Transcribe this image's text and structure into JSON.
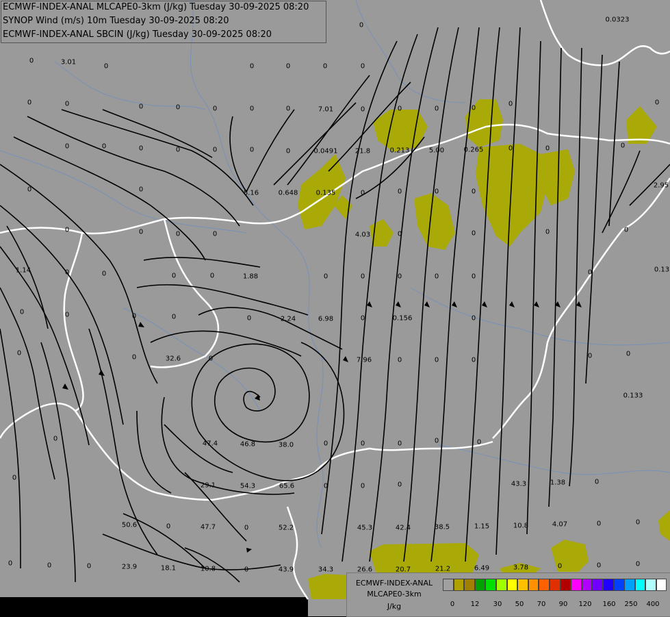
{
  "header": {
    "line1": "ECMWF-INDEX-ANAL MLCAPE0-3km (J/kg) Tuesday 30-09-2025 08:20",
    "line2": "SYNOP Wind (m/s) 10m Tuesday 30-09-2025 08:20",
    "line3": "ECMWF-INDEX-ANAL SBCIN (J/kg) Tuesday 30-09-2025 08:20"
  },
  "colors": {
    "background": "#9a9a9a",
    "cape_fill": "#aaaa00",
    "border": "#ffffff",
    "river": "#6f8fbf",
    "streamline": "#000000"
  },
  "legend": {
    "title1": "ECMWF-INDEX-ANAL",
    "title2": "MLCAPE0-3km",
    "unit": "J/kg",
    "colors": [
      "#a0a0a0",
      "#b0a000",
      "#a08000",
      "#00a000",
      "#00e000",
      "#a0ff00",
      "#ffff00",
      "#ffc000",
      "#ff9000",
      "#ff6000",
      "#e03000",
      "#b00000",
      "#ff00ff",
      "#b000ff",
      "#7000ff",
      "#2000ff",
      "#0040ff",
      "#00a0ff",
      "#00ffff",
      "#b0ffff",
      "#ffffff"
    ],
    "ticks": [
      "0",
      "12",
      "30",
      "50",
      "70",
      "90",
      "120",
      "160",
      "250",
      "400"
    ]
  },
  "values": [
    "0",
    "0.0323",
    "3.01",
    "0",
    "0",
    "0",
    "0",
    "0",
    "0",
    "0",
    "0",
    "0",
    "0",
    "0",
    "0",
    "0",
    "0",
    "0",
    "0",
    "0",
    "7.01",
    "0",
    "0",
    "0",
    "0",
    "0",
    "0",
    "0",
    "0",
    "0",
    "0",
    "0.0491",
    "21.8",
    "0.213",
    "5.00",
    "0.265",
    "0",
    "0",
    "0",
    "0",
    "8.16",
    "0.648",
    "0.135",
    "0",
    "0",
    "0",
    "0",
    "2.95",
    "1.14",
    "0",
    "0",
    "0",
    "0",
    "4.03",
    "0",
    "0",
    "0",
    "0",
    "0.13",
    "0",
    "1.88",
    "0",
    "0",
    "0",
    "0",
    "0",
    "0",
    "0",
    "0",
    "0",
    "2.24",
    "6.98",
    "0",
    "0.156",
    "0",
    "0",
    "0",
    "0",
    "0",
    "0",
    "32.6",
    "0",
    "0",
    "7.96",
    "0",
    "0",
    "0",
    "0",
    "0",
    "0",
    "0.133",
    "0",
    "47.4",
    "46.8",
    "38.0",
    "0",
    "0",
    "0",
    "0",
    "0",
    "29.1",
    "54.3",
    "65.6",
    "0",
    "0",
    "0",
    "43.3",
    "1.38",
    "0",
    "0",
    "50.6",
    "0",
    "47.7",
    "0",
    "52.2",
    "45.3",
    "42.4",
    "38.5",
    "1.15",
    "10.8",
    "4.07",
    "0",
    "0",
    "0",
    "23.9",
    "18.1",
    "10.8",
    "0",
    "43.9",
    "34.3",
    "26.6",
    "20.7",
    "21.2",
    "6.49",
    "3.78",
    "0",
    "0",
    "0",
    "0",
    "0"
  ]
}
